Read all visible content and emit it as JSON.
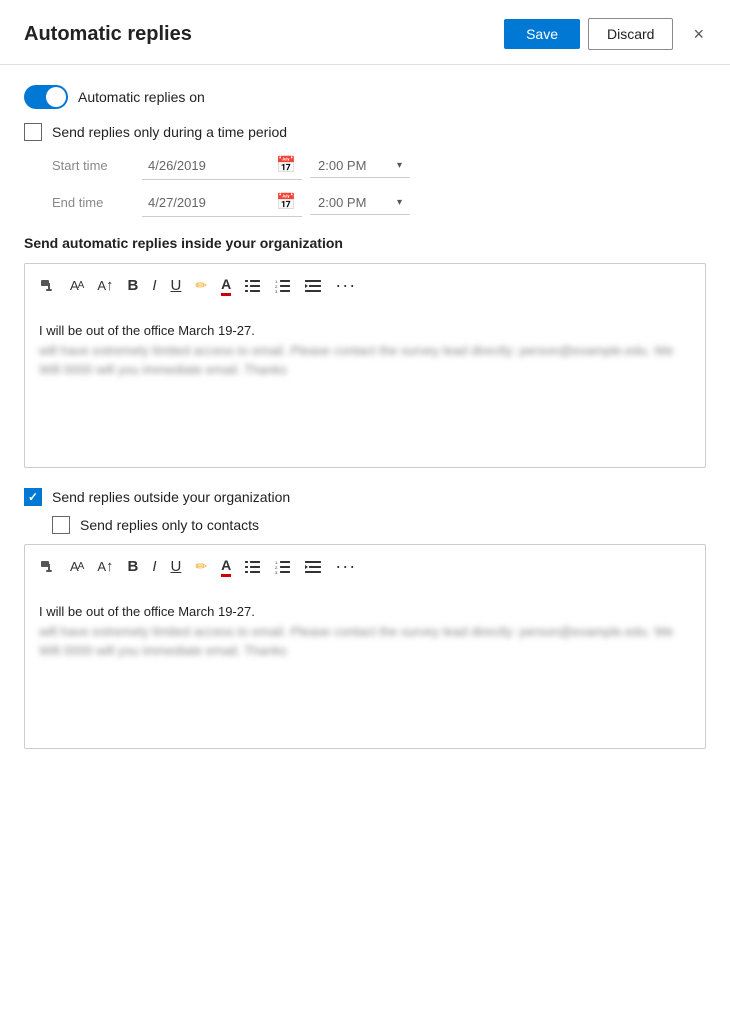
{
  "header": {
    "title": "Automatic replies",
    "save_label": "Save",
    "discard_label": "Discard",
    "close_icon": "×"
  },
  "toggle": {
    "label": "Automatic replies on",
    "enabled": true
  },
  "time_period": {
    "checkbox_label": "Send replies only during a time period",
    "checked": false,
    "start": {
      "label": "Start time",
      "date": "4/26/2019",
      "time": "2:00 PM"
    },
    "end": {
      "label": "End time",
      "date": "4/27/2019",
      "time": "2:00 PM"
    }
  },
  "inside_org": {
    "heading": "Send automatic replies inside your organization",
    "editor_text": "I will be out of the office March 19-27.",
    "blurred_line1": "will have extremely limited access to email. Please contact the survey lead directly: person@example.edu. We Will 0000 will you immediate email. Thanks",
    "toolbar": {
      "format_painter": "🖌",
      "font_size_decrease": "AA",
      "font_size_increase": "A↑",
      "bold": "B",
      "italic": "I",
      "underline": "U",
      "highlight": "✏",
      "font_color": "A",
      "list_bullets": "≡",
      "list_numbers": "≣",
      "indent": "⇤",
      "more": "···"
    }
  },
  "outside_org": {
    "checkbox_label": "Send replies outside your organization",
    "checked": true,
    "contacts_checkbox_label": "Send replies only to contacts",
    "contacts_checked": false,
    "editor_text": "I will be out of the office March 19-27.",
    "blurred_line1": "will have extremely limited access to email. Please contact the survey lead directly: person@example.edu. We Will 0000 will you immediate email. Thanks"
  }
}
